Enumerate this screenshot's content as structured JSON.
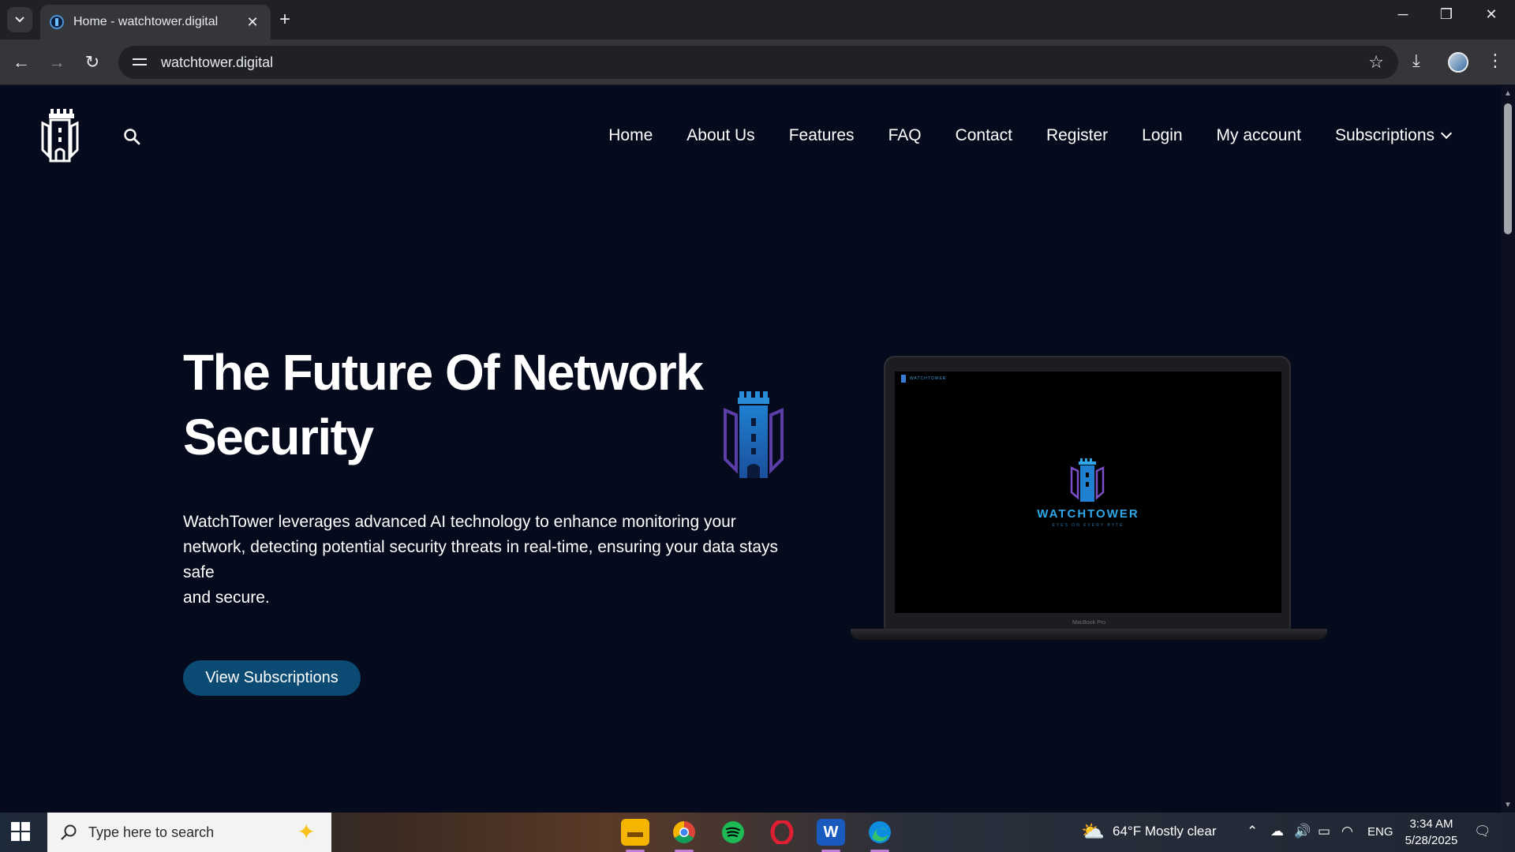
{
  "browser": {
    "tab_title": "Home - watchtower.digital",
    "url": "watchtower.digital"
  },
  "site": {
    "nav": [
      {
        "label": "Home"
      },
      {
        "label": "About Us"
      },
      {
        "label": "Features"
      },
      {
        "label": "FAQ"
      },
      {
        "label": "Contact"
      },
      {
        "label": "Register"
      },
      {
        "label": "Login"
      },
      {
        "label": "My account"
      },
      {
        "label": "Subscriptions"
      }
    ],
    "hero": {
      "title_line1": "The Future Of Network",
      "title_line2": "Security",
      "text_line1": "WatchTower leverages advanced AI technology to enhance monitoring your",
      "text_line2": "network, detecting potential security threats in real-time, ensuring your data stays",
      "text_line3": "safe",
      "text_line4": "and secure.",
      "cta_label": "View Subscriptions"
    },
    "mockup": {
      "mini_brand": "WATCHTOWER",
      "brand": "WATCHTOWER",
      "tagline": "EYES ON EVERY BYTE",
      "device_label": "MacBook Pro"
    }
  },
  "taskbar": {
    "search_placeholder": "Type here to search",
    "weather": "64°F  Mostly clear",
    "language": "ENG",
    "time": "3:34 AM",
    "date": "5/28/2025"
  },
  "colors": {
    "page_bg": "#050a1c",
    "cta_bg": "#0b4a72",
    "brand_blue": "#2fa7e8",
    "emblem_purple": "#5b3ea8"
  }
}
